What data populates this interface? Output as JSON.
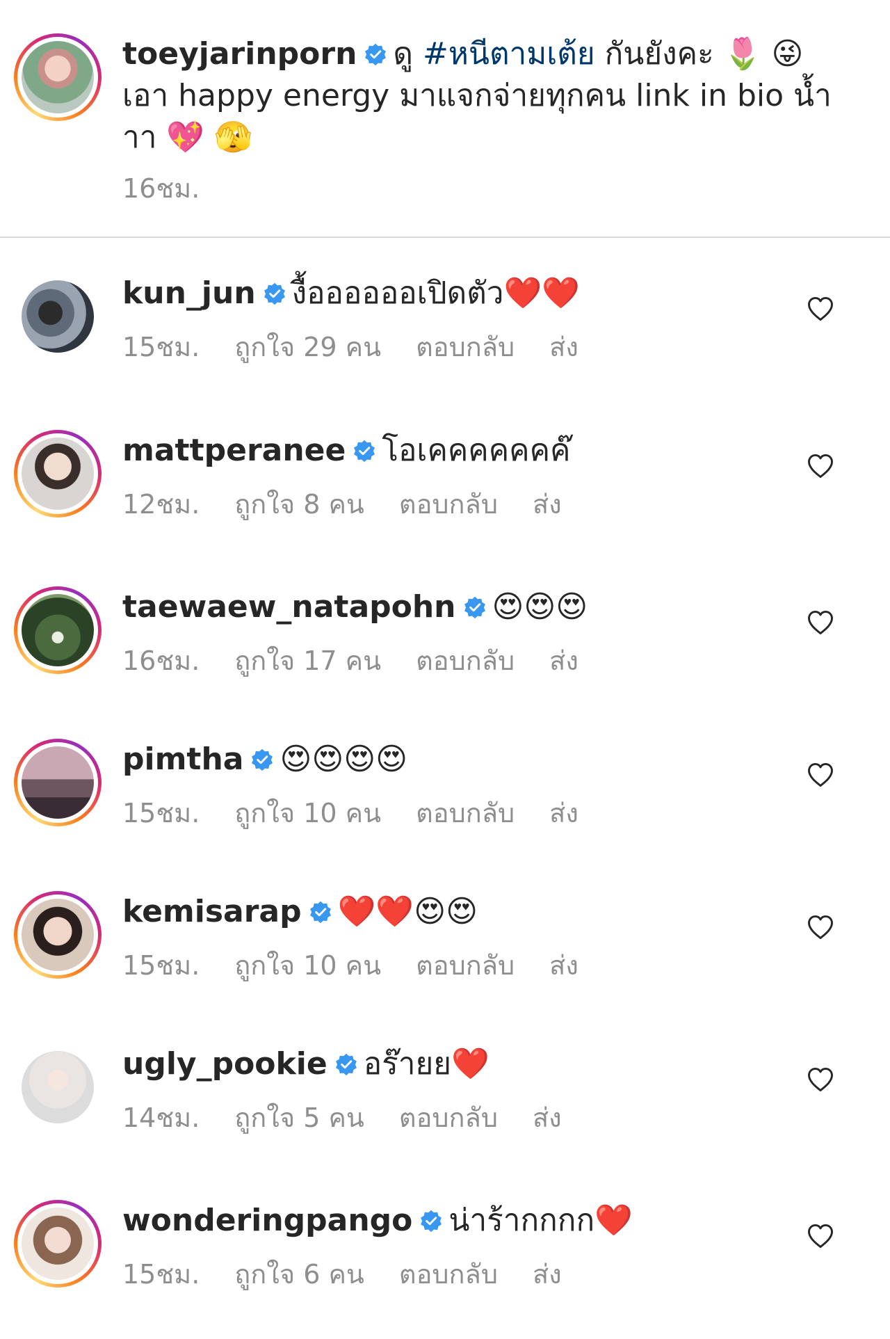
{
  "post": {
    "username": "toeyjarinporn",
    "text_before_hashtag": "ดู",
    "hashtag": "#หนีตามเต้ย",
    "text_after_hashtag": "กันยังคะ 🌷 😜 เอา happy energy มาแจกจ่ายทุกคน link in bio น้ำาา 💖 🫣",
    "time": "16ชม."
  },
  "labels": {
    "likes_prefix": "ถูกใจ",
    "likes_suffix": "คน",
    "reply": "ตอบกลับ",
    "send": "ส่ง"
  },
  "comments": [
    {
      "username": "kun_jun",
      "text": "งื้ออออออเปิดตัว❤️❤️",
      "time": "15ชม.",
      "likes": "29",
      "story_ring": false
    },
    {
      "username": "mattperanee",
      "text": "โอเคคคคคคค๊",
      "time": "12ชม.",
      "likes": "8",
      "story_ring": true
    },
    {
      "username": "taewaew_natapohn",
      "text": "😍😍😍",
      "time": "16ชม.",
      "likes": "17",
      "story_ring": true
    },
    {
      "username": "pimtha",
      "text": "😍😍😍😍",
      "time": "15ชม.",
      "likes": "10",
      "story_ring": true
    },
    {
      "username": "kemisarap",
      "text": "❤️❤️😍😍",
      "time": "15ชม.",
      "likes": "10",
      "story_ring": true
    },
    {
      "username": "ugly_pookie",
      "text": "อร๊ายย❤️",
      "time": "14ชม.",
      "likes": "5",
      "story_ring": false
    },
    {
      "username": "wonderingpango",
      "text": "น่าร้ากกกก❤️",
      "time": "15ชม.",
      "likes": "6",
      "story_ring": true
    }
  ],
  "icons": {
    "verified": "verified-badge-icon",
    "like": "heart-outline-icon"
  },
  "colors": {
    "verified": "#3897f0",
    "text": "#262626",
    "secondary": "#8e8e8e",
    "hashtag": "#00376b",
    "divider": "#dbdbdb"
  }
}
